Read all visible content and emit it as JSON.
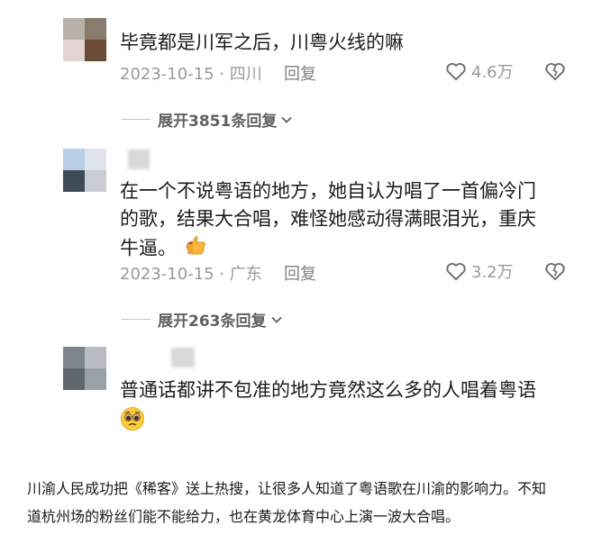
{
  "comments": [
    {
      "text": "毕竟都是川军之后，川粤火线的嘛",
      "date_location": "2023-10-15 · 四川",
      "reply_label": "回复",
      "likes": "4.6万",
      "expand_label": "展开3851条回复"
    },
    {
      "text_line1": "在一个不说粤语的地方，她自认为唱了一首偏冷门",
      "text_line2": "的歌，结果大合唱，难怪她感动得满眼泪光，重庆",
      "text_line3": "牛逼。",
      "date_location": "2023-10-15 · 广东",
      "reply_label": "回复",
      "likes": "3.2万",
      "expand_label": "展开263条回复"
    },
    {
      "text": "普通话都讲不包准的地方竟然这么多的人唱着粤语"
    }
  ],
  "article": {
    "line1": "川渝人民成功把《稀客》送上热搜，让很多人知道了粤语歌在川渝的影响力。不知",
    "line2": "道杭州场的粉丝们能不能给力，也在黄龙体育中心上演一波大合唱。"
  },
  "icons": {
    "like": "heart-outline-icon",
    "dislike": "broken-heart-icon",
    "expand": "chevron-down-icon",
    "thumbs_up": "thumbs-up-emoji",
    "pleading": "pleading-face-emoji"
  },
  "colors": {
    "text": "#1c1c1c",
    "meta": "#9a9a9a",
    "expand": "#606060"
  }
}
